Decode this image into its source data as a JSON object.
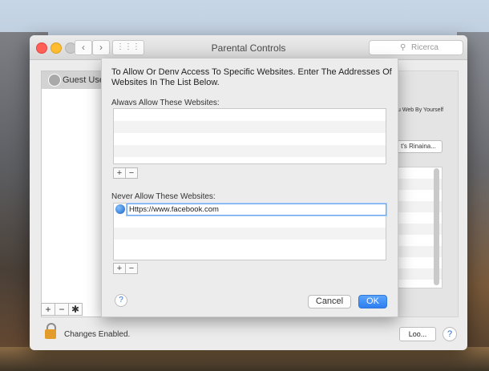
{
  "window": {
    "title": "Parental Controls",
    "search_placeholder": "Ricerca",
    "nav_back": "‹",
    "nav_forward": "›",
    "grid_glyph": "⋮⋮⋮"
  },
  "sidebar": {
    "user_label": "Guest User",
    "add_label": "+",
    "remove_label": "−",
    "gear_label": "✱"
  },
  "background_panel": {
    "snippet_text": "u Web By Yourself",
    "button_label": "t's Rinaina...",
    "lock_status": "Changes Enabled.",
    "login_button": "Loo...",
    "help_label": "?"
  },
  "sheet": {
    "instructions": "To Allow Or Denv Access To Specific Websites. Enter The Addresses Of Websites In The List Below.",
    "always_allow_label": "Alwavs Allow These Websites:",
    "never_allow_label": "Never Allow These Websites:",
    "never_allow_entry": "Https://www.facebook.com",
    "add_label": "+",
    "remove_label": "−",
    "help_label": "?",
    "cancel_label": "Cancel",
    "ok_label": "OK"
  },
  "icons": [
    "search-icon",
    "globe-icon",
    "lock-icon",
    "gear-icon",
    "user-avatar"
  ]
}
